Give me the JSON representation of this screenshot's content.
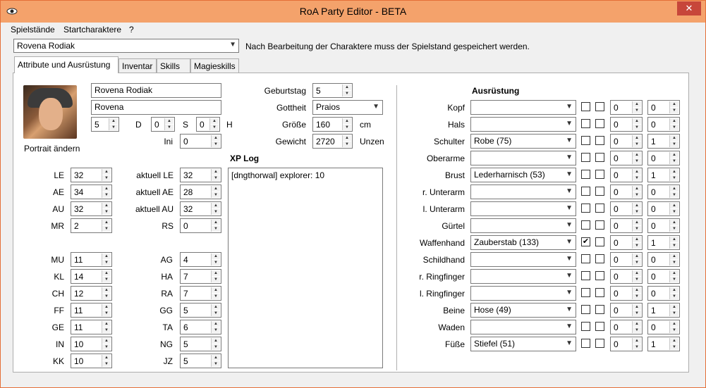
{
  "window": {
    "title": "RoA Party Editor - BETA",
    "close_glyph": "✕"
  },
  "menu": [
    "Spielstände",
    "Startcharaktere",
    "?"
  ],
  "character_select": {
    "value": "Rovena Rodiak",
    "note": "Nach Bearbeitung der Charaktere muss der Spielstand gespeichert werden."
  },
  "tabs": [
    "Attribute und Ausrüstung",
    "Inventar",
    "Skills",
    "Magieskills"
  ],
  "character": {
    "name": "Rovena Rodiak",
    "short_name": "Rovena",
    "portrait_label": "Portrait ändern",
    "coins": [
      {
        "value": "5",
        "label": "D"
      },
      {
        "value": "0",
        "label": "S"
      },
      {
        "value": "0",
        "label": "H"
      }
    ],
    "ini": {
      "label": "Ini",
      "value": "0"
    },
    "birthday": {
      "label": "Geburtstag",
      "value": "5"
    },
    "god": {
      "label": "Gottheit",
      "value": "Praios"
    },
    "height": {
      "label": "Größe",
      "value": "160",
      "unit": "cm"
    },
    "weight": {
      "label": "Gewicht",
      "value": "2720",
      "unit": "Unzen"
    }
  },
  "points": [
    {
      "label": "LE",
      "value": "32",
      "cur_label": "aktuell LE",
      "cur_value": "32"
    },
    {
      "label": "AE",
      "value": "34",
      "cur_label": "aktuell AE",
      "cur_value": "28"
    },
    {
      "label": "AU",
      "value": "32",
      "cur_label": "aktuell AU",
      "cur_value": "32"
    },
    {
      "label": "MR",
      "value": "2",
      "cur_label": "RS",
      "cur_value": "0"
    }
  ],
  "attributes": [
    {
      "label": "MU",
      "value": "11",
      "neg_label": "AG",
      "neg_value": "4"
    },
    {
      "label": "KL",
      "value": "14",
      "neg_label": "HA",
      "neg_value": "7"
    },
    {
      "label": "CH",
      "value": "12",
      "neg_label": "RA",
      "neg_value": "7"
    },
    {
      "label": "FF",
      "value": "11",
      "neg_label": "GG",
      "neg_value": "5"
    },
    {
      "label": "GE",
      "value": "11",
      "neg_label": "TA",
      "neg_value": "6"
    },
    {
      "label": "IN",
      "value": "10",
      "neg_label": "NG",
      "neg_value": "5"
    },
    {
      "label": "KK",
      "value": "10",
      "neg_label": "JZ",
      "neg_value": "5"
    }
  ],
  "xp_log": {
    "title": "XP Log",
    "text": "[dngthorwal] explorer: 10"
  },
  "equipment": {
    "title": "Ausrüstung",
    "slots": [
      {
        "label": "Kopf",
        "item": "",
        "c1": false,
        "c2": false,
        "n1": "0",
        "n2": "0"
      },
      {
        "label": "Hals",
        "item": "",
        "c1": false,
        "c2": false,
        "n1": "0",
        "n2": "0"
      },
      {
        "label": "Schulter",
        "item": "Robe (75)",
        "c1": false,
        "c2": false,
        "n1": "0",
        "n2": "1"
      },
      {
        "label": "Oberarme",
        "item": "",
        "c1": false,
        "c2": false,
        "n1": "0",
        "n2": "0"
      },
      {
        "label": "Brust",
        "item": "Lederharnisch (53)",
        "c1": false,
        "c2": false,
        "n1": "0",
        "n2": "1"
      },
      {
        "label": "r. Unterarm",
        "item": "",
        "c1": false,
        "c2": false,
        "n1": "0",
        "n2": "0"
      },
      {
        "label": "l. Unterarm",
        "item": "",
        "c1": false,
        "c2": false,
        "n1": "0",
        "n2": "0"
      },
      {
        "label": "Gürtel",
        "item": "",
        "c1": false,
        "c2": false,
        "n1": "0",
        "n2": "0"
      },
      {
        "label": "Waffenhand",
        "item": "Zauberstab (133)",
        "c1": true,
        "c2": false,
        "n1": "0",
        "n2": "1"
      },
      {
        "label": "Schildhand",
        "item": "",
        "c1": false,
        "c2": false,
        "n1": "0",
        "n2": "0"
      },
      {
        "label": "r. Ringfinger",
        "item": "",
        "c1": false,
        "c2": false,
        "n1": "0",
        "n2": "0"
      },
      {
        "label": "l. Ringfinger",
        "item": "",
        "c1": false,
        "c2": false,
        "n1": "0",
        "n2": "0"
      },
      {
        "label": "Beine",
        "item": "Hose (49)",
        "c1": false,
        "c2": false,
        "n1": "0",
        "n2": "1"
      },
      {
        "label": "Waden",
        "item": "",
        "c1": false,
        "c2": false,
        "n1": "0",
        "n2": "0"
      },
      {
        "label": "Füße",
        "item": "Stiefel (51)",
        "c1": false,
        "c2": false,
        "n1": "0",
        "n2": "1"
      }
    ]
  }
}
